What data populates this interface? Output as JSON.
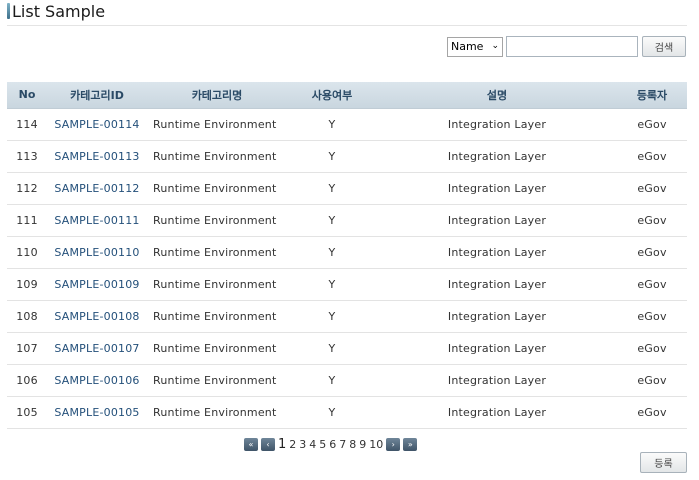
{
  "page": {
    "title": "List Sample"
  },
  "search": {
    "select_value": "Name",
    "input_value": "",
    "button_label": "검색"
  },
  "table": {
    "headers": [
      "No",
      "카테고리ID",
      "카테고리명",
      "사용여부",
      "설명",
      "등록자"
    ],
    "rows": [
      {
        "no": "114",
        "id": "SAMPLE-00114",
        "name": "Runtime Environment",
        "use": "Y",
        "desc": "Integration Layer",
        "reg": "eGov"
      },
      {
        "no": "113",
        "id": "SAMPLE-00113",
        "name": "Runtime Environment",
        "use": "Y",
        "desc": "Integration Layer",
        "reg": "eGov"
      },
      {
        "no": "112",
        "id": "SAMPLE-00112",
        "name": "Runtime Environment",
        "use": "Y",
        "desc": "Integration Layer",
        "reg": "eGov"
      },
      {
        "no": "111",
        "id": "SAMPLE-00111",
        "name": "Runtime Environment",
        "use": "Y",
        "desc": "Integration Layer",
        "reg": "eGov"
      },
      {
        "no": "110",
        "id": "SAMPLE-00110",
        "name": "Runtime Environment",
        "use": "Y",
        "desc": "Integration Layer",
        "reg": "eGov"
      },
      {
        "no": "109",
        "id": "SAMPLE-00109",
        "name": "Runtime Environment",
        "use": "Y",
        "desc": "Integration Layer",
        "reg": "eGov"
      },
      {
        "no": "108",
        "id": "SAMPLE-00108",
        "name": "Runtime Environment",
        "use": "Y",
        "desc": "Integration Layer",
        "reg": "eGov"
      },
      {
        "no": "107",
        "id": "SAMPLE-00107",
        "name": "Runtime Environment",
        "use": "Y",
        "desc": "Integration Layer",
        "reg": "eGov"
      },
      {
        "no": "106",
        "id": "SAMPLE-00106",
        "name": "Runtime Environment",
        "use": "Y",
        "desc": "Integration Layer",
        "reg": "eGov"
      },
      {
        "no": "105",
        "id": "SAMPLE-00105",
        "name": "Runtime Environment",
        "use": "Y",
        "desc": "Integration Layer",
        "reg": "eGov"
      }
    ]
  },
  "pagination": {
    "first_icon": "double-chevron-left-icon",
    "prev_icon": "chevron-left-icon",
    "pages": [
      "1",
      "2",
      "3",
      "4",
      "5",
      "6",
      "7",
      "8",
      "9",
      "10"
    ],
    "current": "1",
    "next_icon": "chevron-right-icon",
    "last_icon": "double-chevron-right-icon"
  },
  "footer": {
    "register_label": "등록"
  }
}
